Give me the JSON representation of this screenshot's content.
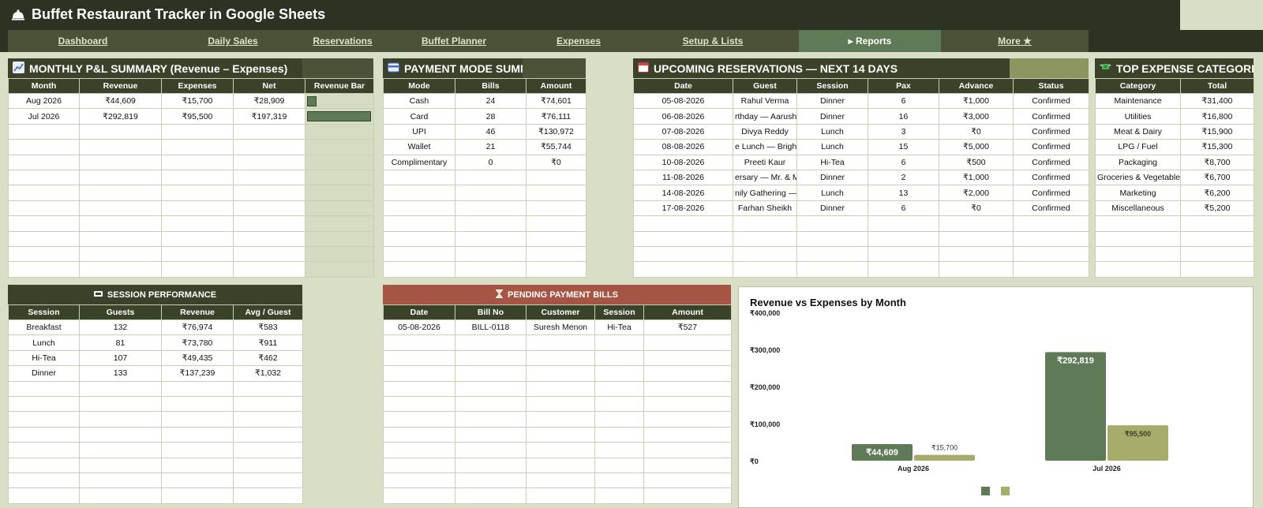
{
  "app": {
    "title": "Buffet Restaurant Tracker in Google Sheets"
  },
  "nav": {
    "tabs": [
      {
        "label": "Dashboard"
      },
      {
        "label": "Daily Sales"
      },
      {
        "label": "Reservations"
      },
      {
        "label": "Buffet Planner"
      },
      {
        "label": "Expenses"
      },
      {
        "label": "Setup & Lists"
      },
      {
        "label": "▸ Reports",
        "active": true
      },
      {
        "label": "More ★"
      }
    ]
  },
  "pnl": {
    "title": "MONTHLY P&L SUMMARY (Revenue – Expenses)",
    "headers": [
      "Month",
      "Revenue",
      "Expenses",
      "Net",
      "Revenue Bar"
    ],
    "rows": [
      {
        "month": "Aug 2026",
        "revenue": "₹44,609",
        "expenses": "₹15,700",
        "net": "₹28,909",
        "bar_fraction": 0.152
      },
      {
        "month": "Jul 2026",
        "revenue": "₹292,819",
        "expenses": "₹95,500",
        "net": "₹197,319",
        "bar_fraction": 1.0
      }
    ]
  },
  "payment": {
    "title": "PAYMENT MODE SUMMARY",
    "headers": [
      "Mode",
      "Bills",
      "Amount"
    ],
    "rows": [
      [
        "Cash",
        "24",
        "₹74,601"
      ],
      [
        "Card",
        "28",
        "₹76,111"
      ],
      [
        "UPI",
        "46",
        "₹130,972"
      ],
      [
        "Wallet",
        "21",
        "₹55,744"
      ],
      [
        "Complimentary",
        "0",
        "₹0"
      ]
    ]
  },
  "reservations": {
    "title": "UPCOMING RESERVATIONS — NEXT 14 DAYS",
    "headers": [
      "Date",
      "Guest",
      "Session",
      "Pax",
      "Advance",
      "Status"
    ],
    "rows": [
      [
        "05-08-2026",
        "Rahul Verma",
        "Dinner",
        "6",
        "₹1,000",
        "Confirmed"
      ],
      [
        "06-08-2026",
        "rthday — Aarush (1",
        "Dinner",
        "16",
        "₹3,000",
        "Confirmed"
      ],
      [
        "07-08-2026",
        "Divya Reddy",
        "Lunch",
        "3",
        "₹0",
        "Confirmed"
      ],
      [
        "08-08-2026",
        "e Lunch — BrightW",
        "Lunch",
        "15",
        "₹5,000",
        "Confirmed"
      ],
      [
        "10-08-2026",
        "Preeti Kaur",
        "Hi-Tea",
        "6",
        "₹500",
        "Confirmed"
      ],
      [
        "11-08-2026",
        "ersary — Mr. & Mrs",
        "Dinner",
        "2",
        "₹1,000",
        "Confirmed"
      ],
      [
        "14-08-2026",
        "nily Gathering — Si",
        "Lunch",
        "13",
        "₹2,000",
        "Confirmed"
      ],
      [
        "17-08-2026",
        "Farhan Sheikh",
        "Dinner",
        "6",
        "₹0",
        "Confirmed"
      ]
    ]
  },
  "expenses": {
    "title": "TOP EXPENSE CATEGORIES",
    "headers": [
      "Category",
      "Total"
    ],
    "rows": [
      [
        "Maintenance",
        "₹31,400"
      ],
      [
        "Utilities",
        "₹16,800"
      ],
      [
        "Meat & Dairy",
        "₹15,900"
      ],
      [
        "LPG / Fuel",
        "₹15,300"
      ],
      [
        "Packaging",
        "₹8,700"
      ],
      [
        "Groceries & Vegetables",
        "₹6,700"
      ],
      [
        "Marketing",
        "₹6,200"
      ],
      [
        "Miscellaneous",
        "₹5,200"
      ]
    ]
  },
  "session": {
    "title": "SESSION PERFORMANCE",
    "headers": [
      "Session",
      "Guests",
      "Revenue",
      "Avg / Guest"
    ],
    "rows": [
      [
        "Breakfast",
        "132",
        "₹76,974",
        "₹583"
      ],
      [
        "Lunch",
        "81",
        "₹73,780",
        "₹911"
      ],
      [
        "Hi-Tea",
        "107",
        "₹49,435",
        "₹462"
      ],
      [
        "Dinner",
        "133",
        "₹137,239",
        "₹1,032"
      ]
    ]
  },
  "pending": {
    "title": "PENDING PAYMENT BILLS",
    "headers": [
      "Date",
      "Bill No",
      "Customer",
      "Session",
      "Amount"
    ],
    "rows": [
      [
        "05-08-2026",
        "BILL-0118",
        "Suresh Menon",
        "Hi-Tea",
        "₹527"
      ]
    ]
  },
  "colors": {
    "header_dark": "#3a4229",
    "revenue": "#5f7a56",
    "expenses": "#a7ac6a",
    "pending_header": "#a65444",
    "background": "#d9dfc6"
  },
  "chart_data": {
    "type": "bar",
    "title": "Revenue vs Expenses by Month",
    "categories": [
      "Aug 2026",
      "Jul 2026"
    ],
    "series": [
      {
        "values": [
          44609,
          292819
        ],
        "labels": [
          "₹44,609",
          "₹292,819"
        ],
        "color": "#5f7a56"
      },
      {
        "values": [
          15700,
          95500
        ],
        "labels": [
          "₹15,700",
          "₹95,500"
        ],
        "color": "#a7ac6a"
      }
    ],
    "yticks": [
      "₹0",
      "₹100,000",
      "₹200,000",
      "₹300,000",
      "₹400,000"
    ],
    "ytick_values": [
      0,
      100000,
      200000,
      300000,
      400000
    ],
    "ylim": [
      0,
      400000
    ],
    "legend": "bottom",
    "grid": false
  }
}
